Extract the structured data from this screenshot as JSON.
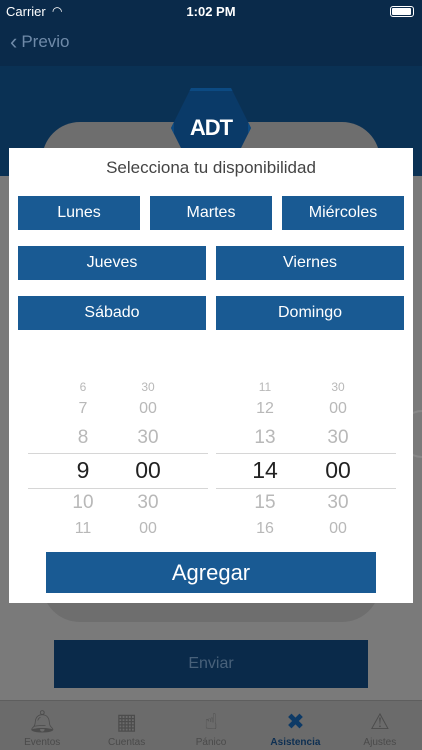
{
  "status_bar": {
    "carrier": "Carrier",
    "time": "1:02 PM"
  },
  "nav": {
    "back_label": "Previo"
  },
  "logo": {
    "text": "ADT"
  },
  "footer": {
    "send_label": "Enviar"
  },
  "tabs": [
    {
      "label": "Eventos",
      "icon": "bell-icon"
    },
    {
      "label": "Cuentas",
      "icon": "keypad-icon"
    },
    {
      "label": "Pánico",
      "icon": "hand-icon"
    },
    {
      "label": "Asistencia",
      "icon": "tools-icon",
      "active": true
    },
    {
      "label": "Ajustes",
      "icon": "warning-icon"
    }
  ],
  "modal": {
    "title": "Selecciona tu disponibilidad",
    "days": [
      "Lunes",
      "Martes",
      "Miércoles",
      "Jueves",
      "Viernes",
      "Sábado",
      "Domingo"
    ],
    "start_time": {
      "hours": [
        "6",
        "7",
        "8",
        "9",
        "10",
        "11"
      ],
      "minutes": [
        "30",
        "00",
        "30",
        "00",
        "30",
        "00"
      ],
      "selected_hour": "9",
      "selected_minute": "00"
    },
    "end_time": {
      "hours": [
        "11",
        "12",
        "13",
        "14",
        "15",
        "16"
      ],
      "minutes": [
        "30",
        "00",
        "30",
        "00",
        "30",
        "00"
      ],
      "selected_hour": "14",
      "selected_minute": "00"
    },
    "add_label": "Agregar"
  },
  "colors": {
    "primary": "#195a93",
    "navy": "#0a2a4a",
    "overlay": "#7a7a7a"
  }
}
